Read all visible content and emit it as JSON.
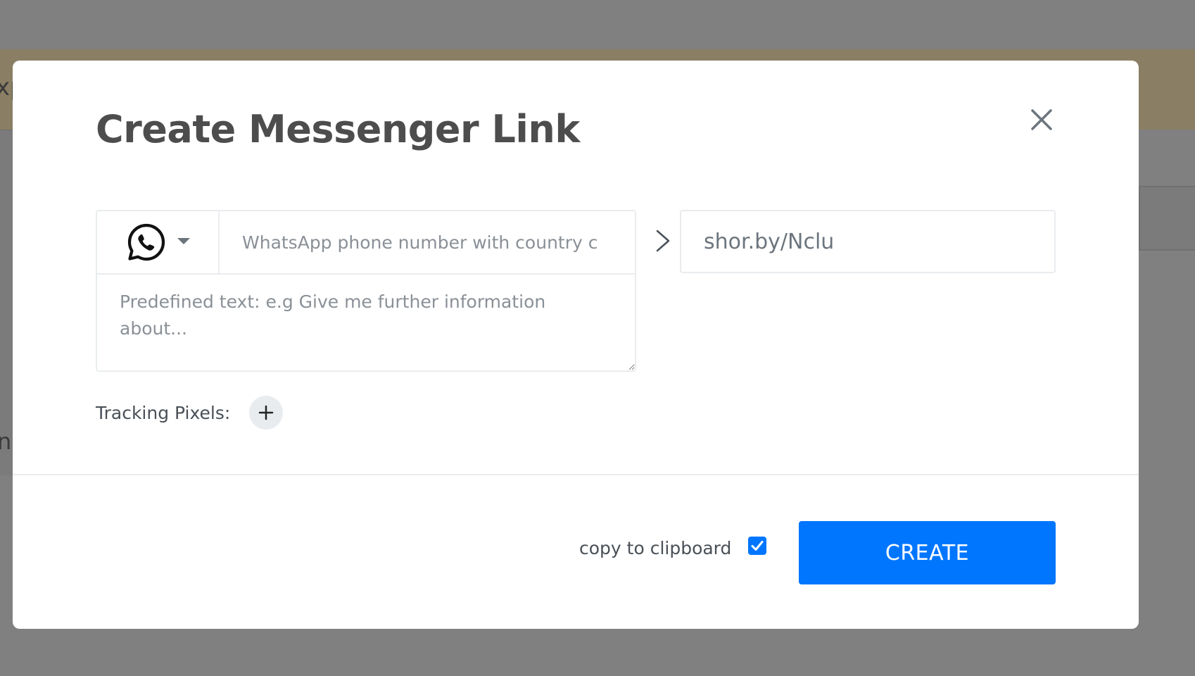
{
  "background": {
    "left_fragment_top": "xp",
    "left_fragment_bottom": "n"
  },
  "modal": {
    "title": "Create Messenger Link",
    "close_icon": "close-icon",
    "platform": {
      "selected": "WhatsApp",
      "icon": "whatsapp-icon"
    },
    "phone_placeholder": "WhatsApp phone number with country c",
    "predefined_placeholder": "Predefined text: e.g Give me further information about...",
    "short_link": "shor.by/Nclu",
    "tracking_label": "Tracking Pixels:",
    "copy_label": "copy to clipboard",
    "copy_checked": true,
    "create_label": "CREATE"
  },
  "colors": {
    "accent": "#0076ff",
    "title": "#4d4d4d",
    "overlay": "#808080"
  }
}
